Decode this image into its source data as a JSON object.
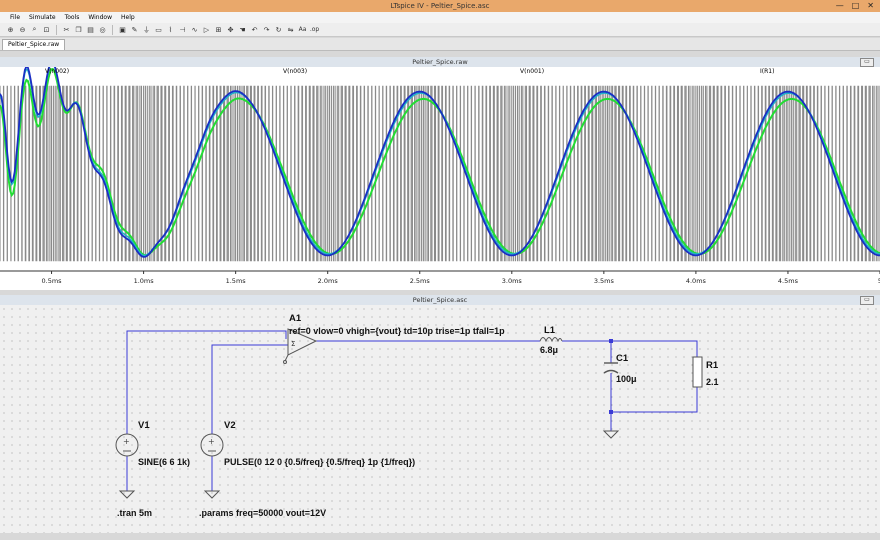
{
  "window": {
    "title": "LTspice IV - Peltier_Spice.asc",
    "controls": [
      "—",
      "□",
      "✕"
    ]
  },
  "menu": {
    "items": [
      "File",
      "Simulate",
      "Tools",
      "Window",
      "Help"
    ]
  },
  "toolbar": {
    "icons": [
      "zoom-in-icon",
      "zoom-out-icon",
      "zoom-fit-icon",
      "zoom-area-icon",
      "cut-icon",
      "copy-icon",
      "paste-icon",
      "find-icon",
      "print-icon",
      "wire-icon",
      "ground-icon",
      "label-icon",
      "resistor-icon",
      "capacitor-icon",
      "inductor-icon",
      "diode-icon",
      "component-icon",
      "move-icon",
      "drag-icon",
      "undo-icon",
      "redo-icon",
      "rotate-icon",
      "mirror-icon",
      "text-icon",
      "spice-directive-icon"
    ]
  },
  "tabs": {
    "active": "Peltier_Spice.raw"
  },
  "waveform_panel": {
    "title": "Peltier_Spice.raw",
    "traces": [
      {
        "label": "V(n002)",
        "color": "#8a8a8a"
      },
      {
        "label": "V(n003)",
        "color": "#1a2ec4"
      },
      {
        "label": "V(n001)",
        "color": "#20b2c8"
      },
      {
        "label": "I(R1)",
        "color": "#22dd33"
      }
    ],
    "x_ticks": [
      "0.5ms",
      "1.0ms",
      "1.5ms",
      "2.0ms",
      "2.5ms",
      "3.0ms",
      "3.5ms",
      "4.0ms",
      "4.5ms",
      "5"
    ]
  },
  "schematic_panel": {
    "title": "Peltier_Spice.asc",
    "components": {
      "A1": {
        "name": "A1",
        "params": "ref=0 vlow=0 vhigh={vout} td=10p trise=1p tfall=1p"
      },
      "L1": {
        "name": "L1",
        "value": "6.8μ"
      },
      "C1": {
        "name": "C1",
        "value": "100μ"
      },
      "R1": {
        "name": "R1",
        "value": "2.1"
      },
      "V1": {
        "name": "V1",
        "value": "SINE(6 6 1k)"
      },
      "V2": {
        "name": "V2",
        "value": "PULSE(0 12 0 {0.5/freq} {0.5/freq} 1p {1/freq})"
      }
    },
    "directives": {
      "tran": ".tran 5m",
      "params": ".params freq=50000 vout=12V"
    }
  },
  "chart_data": {
    "type": "line",
    "x_unit": "ms",
    "xlim": [
      0.22,
      5.0
    ],
    "series": [
      {
        "name": "V(n002)",
        "kind": "pwm",
        "low": 0,
        "high": 12
      },
      {
        "name": "V(n003)",
        "kind": "sine",
        "offset": 6,
        "amplitude": 5.6,
        "freq_khz": 1
      },
      {
        "name": "V(n001)",
        "kind": "sine",
        "offset": 6,
        "amplitude": 5.5,
        "freq_khz": 1
      },
      {
        "name": "I(R1)",
        "kind": "sine",
        "offset": 5.8,
        "amplitude": 5.3,
        "freq_khz": 1
      }
    ]
  }
}
